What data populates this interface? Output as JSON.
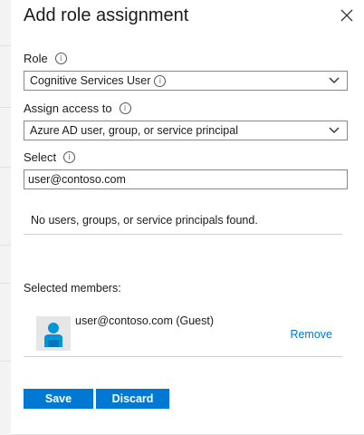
{
  "dialog": {
    "title": "Add role assignment"
  },
  "role": {
    "label": "Role",
    "value": "Cognitive Services User"
  },
  "assign_access": {
    "label": "Assign access to",
    "value": "Azure AD user, group, or service principal"
  },
  "select": {
    "label": "Select",
    "value": "user@contoso.com",
    "no_results": "No users, groups, or service principals found."
  },
  "selected_members": {
    "label": "Selected members:",
    "items": [
      {
        "name": "user@contoso.com (Guest)",
        "remove_label": "Remove"
      }
    ]
  },
  "actions": {
    "save_label": "Save",
    "discard_label": "Discard"
  },
  "colors": {
    "accent": "#0078d4",
    "border": "#8a8886",
    "avatar_person": "#0095d9"
  },
  "icons": {
    "close": "close-icon",
    "info": "info-icon",
    "dropdown": "chevron-down-icon",
    "avatar": "user-avatar-icon"
  }
}
